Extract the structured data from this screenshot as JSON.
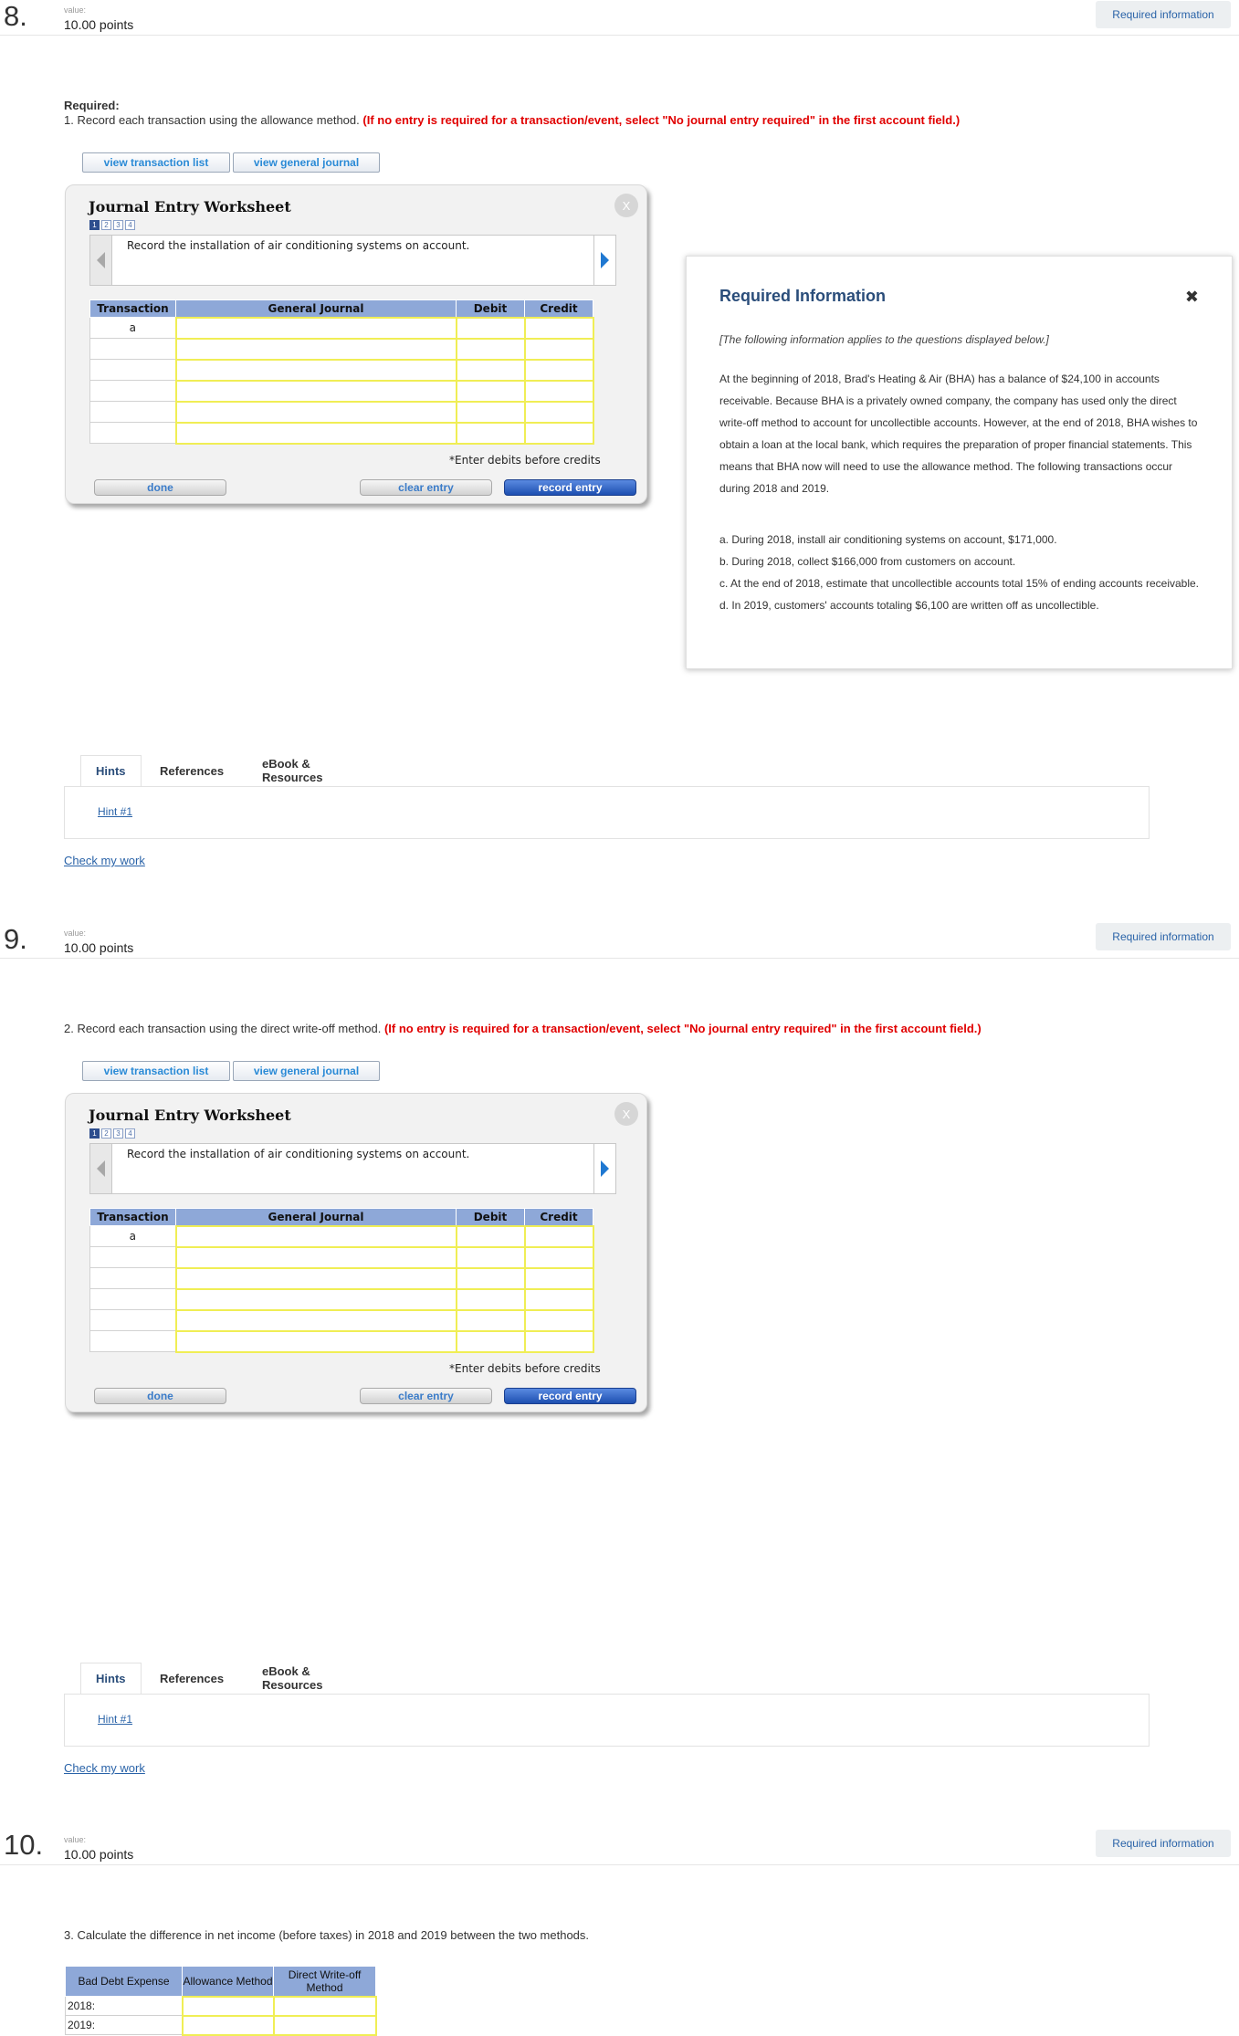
{
  "q8": {
    "number": "8.",
    "value_label": "value:",
    "points": "10.00 points",
    "required_info_btn": "Required information",
    "required_head": "Required:",
    "instruction_prefix": "1. Record each transaction using the allowance method.",
    "instruction_note": "(If no entry is required for a transaction/event, select \"No journal entry required\" in the first account field.)"
  },
  "q9": {
    "number": "9.",
    "value_label": "value:",
    "points": "10.00 points",
    "required_info_btn": "Required information",
    "instruction_prefix": "2. Record each transaction using the direct write-off method.",
    "instruction_note": "(If no entry is required for a transaction/event, select \"No journal entry required\" in the first account field.)"
  },
  "q10": {
    "number": "10.",
    "value_label": "value:",
    "points": "10.00 points",
    "required_info_btn": "Required information",
    "instruction": "3. Calculate the difference in net income (before taxes) in 2018 and 2019 between the two methods."
  },
  "links": {
    "view_transaction_list": "view transaction list",
    "view_general_journal": "view general journal"
  },
  "worksheet": {
    "title": "Journal Entry Worksheet",
    "close": "X",
    "pages": [
      "1",
      "2",
      "3",
      "4"
    ],
    "description": "Record the installation of air conditioning systems on account.",
    "headers": [
      "Transaction",
      "General Journal",
      "Debit",
      "Credit"
    ],
    "first_transaction": "a",
    "note": "*Enter debits before credits",
    "done": "done",
    "clear_entry": "clear entry",
    "record_entry": "record entry"
  },
  "required_information": {
    "title": "Required Information",
    "close": "✖",
    "intro": "[The following information applies to the questions displayed below.]",
    "paragraph": "At the beginning of 2018, Brad's Heating & Air (BHA) has a balance of $24,100 in accounts receivable. Because BHA is a privately owned company, the company has used only the direct write-off method to account for uncollectible accounts. However, at the end of 2018, BHA wishes to obtain a loan at the local bank, which requires the preparation of proper financial statements. This means that BHA now will need to use the allowance method. The following transactions occur during 2018 and 2019.",
    "items": [
      "a. During 2018, install air conditioning systems on account, $171,000.",
      "b. During 2018, collect $166,000 from customers on account.",
      "c. At the end of 2018, estimate that uncollectible accounts total 15% of ending accounts receivable.",
      "d. In 2019, customers' accounts totaling $6,100 are written off as uncollectible."
    ]
  },
  "tabs": {
    "hints": "Hints",
    "references": "References",
    "ebook": "eBook & Resources",
    "hint1": "Hint #1",
    "check": "Check my work"
  },
  "bad_debt_table": {
    "col1": "Bad Debt Expense",
    "col2": "Allowance Method",
    "col3": "Direct Write-off Method",
    "rows": [
      "2018:",
      "2019:"
    ]
  }
}
